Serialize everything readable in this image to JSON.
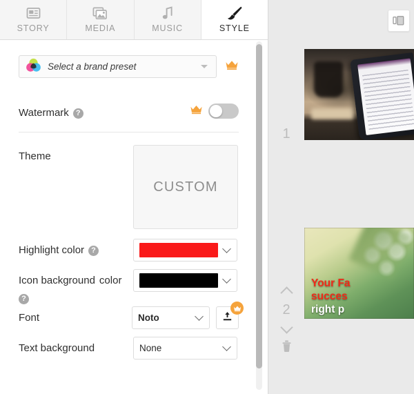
{
  "tabs": [
    {
      "label": "STORY",
      "icon": "story-icon",
      "active": false
    },
    {
      "label": "MEDIA",
      "icon": "media-icon",
      "active": false
    },
    {
      "label": "MUSIC",
      "icon": "music-icon",
      "active": false
    },
    {
      "label": "STYLE",
      "icon": "brush-icon",
      "active": true
    }
  ],
  "style_panel": {
    "brand_preset": {
      "placeholder": "Select a brand preset",
      "icon": "brand-circles-icon",
      "premium_icon": "crown-icon"
    },
    "watermark": {
      "label": "Watermark",
      "help": "?",
      "premium_icon": "crown-icon",
      "enabled": false
    },
    "theme": {
      "label": "Theme",
      "value": "CUSTOM"
    },
    "highlight_color": {
      "label": "Highlight color",
      "help": "?",
      "color": "#FA1A1A"
    },
    "icon_background_color": {
      "label_line1": "Icon background",
      "label_line2": "color",
      "help": "?",
      "color": "#000000"
    },
    "font": {
      "label": "Font",
      "value": "Noto",
      "upload_icon": "upload-icon",
      "premium_icon": "crown-icon"
    },
    "text_background": {
      "label": "Text background",
      "value": "None"
    }
  },
  "storyboard": {
    "panel_toggle_icon": "panel-collapse-icon",
    "scenes": [
      {
        "number": "1",
        "thumb": "desk-tablet-photo",
        "overlay_lines": []
      },
      {
        "number": "2",
        "thumb": "white-blossoms-photo",
        "overlay_lines": [
          "Your Fa",
          "succes",
          "right p"
        ],
        "move_up_icon": "chevron-up-icon",
        "move_down_icon": "chevron-down-icon",
        "delete_icon": "trash-icon"
      }
    ]
  },
  "colors": {
    "accent_red": "#FA1A1A",
    "premium_orange": "#F5A33C",
    "panel_bg": "#EAEAEA",
    "tabbar_bg": "#F5F5F5"
  }
}
